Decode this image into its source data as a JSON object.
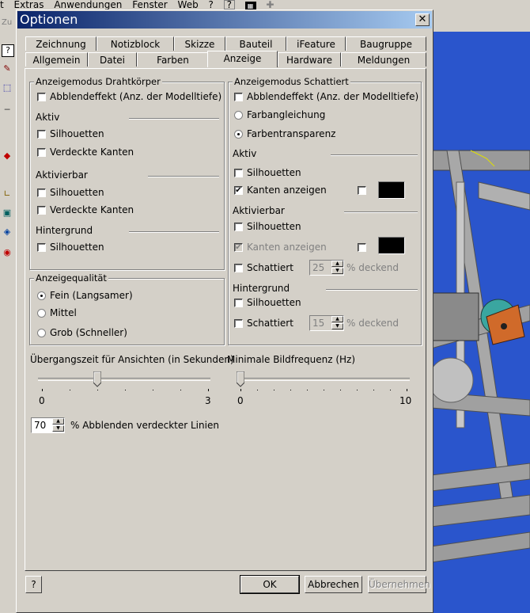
{
  "app": {
    "menu": [
      "t",
      "Extras",
      "Anwendungen",
      "Fenster",
      "Web",
      "?"
    ],
    "left_toolbar_label": "Zu"
  },
  "dialog": {
    "title": "Optionen",
    "close_glyph": "✕",
    "tabs_row1": [
      "Zeichnung",
      "Notizblock",
      "Skizze",
      "Bauteil",
      "iFeature",
      "Baugruppe"
    ],
    "tabs_row2": [
      "Allgemein",
      "Datei",
      "Farben",
      "Anzeige",
      "Hardware",
      "Meldungen"
    ],
    "active_tab": "Anzeige",
    "wireframe": {
      "title": "Anzeigemodus Drahtkörper",
      "dimming_label": "Abblendeffekt (Anz. der Modelltiefe)",
      "dimming_checked": false,
      "active_section": "Aktiv",
      "active_silhouettes": "Silhouetten",
      "active_hidden_edges": "Verdeckte Kanten",
      "activatable_section": "Aktivierbar",
      "activatable_silhouettes": "Silhouetten",
      "activatable_hidden_edges": "Verdeckte Kanten",
      "background_section": "Hintergrund",
      "background_silhouettes": "Silhouetten"
    },
    "shaded": {
      "title": "Anzeigemodus Schattiert",
      "dimming_label": "Abblendeffekt (Anz. der Modelltiefe)",
      "color_fade": "Farbangleichung",
      "color_transparency": "Farbentransparenz",
      "selected_mode": "Farbentransparenz",
      "active_section": "Aktiv",
      "active_silhouettes": "Silhouetten",
      "active_show_edges": "Kanten anzeigen",
      "active_show_edges_checked": true,
      "activatable_section": "Aktivierbar",
      "activatable_silhouettes": "Silhouetten",
      "activatable_show_edges": "Kanten anzeigen",
      "activatable_shaded": "Schattiert",
      "activatable_opacity_value": "25",
      "opacity_unit": "% deckend",
      "background_section": "Hintergrund",
      "background_silhouettes": "Silhouetten",
      "background_shaded": "Schattiert",
      "background_opacity_value": "15",
      "edge_color": "#000000"
    },
    "quality": {
      "title": "Anzeigequalität",
      "fine": "Fein (Langsamer)",
      "medium": "Mittel",
      "coarse": "Grob (Schneller)",
      "selected": "Fein (Langsamer)"
    },
    "transition": {
      "label": "Übergangszeit für Ansichten (in Sekunden)",
      "min_label": "0",
      "max_label": "3",
      "value": 1.0,
      "min": 0,
      "max": 3
    },
    "framerate": {
      "label": "Minimale Bildfrequenz (Hz)",
      "min_label": "0",
      "max_label": "10",
      "value": 0,
      "min": 0,
      "max": 10
    },
    "hidden_lines": {
      "value": "70",
      "label": "% Abblenden verdeckter Linien"
    },
    "buttons": {
      "help": "?",
      "ok": "OK",
      "cancel": "Abbrechen",
      "apply": "Übernehmen"
    }
  },
  "colors": {
    "titlebar_start": "#0a246a",
    "titlebar_end": "#a6caf0",
    "viewport_bg": "#2a55cc",
    "dialog_bg": "#d4d0c8"
  }
}
